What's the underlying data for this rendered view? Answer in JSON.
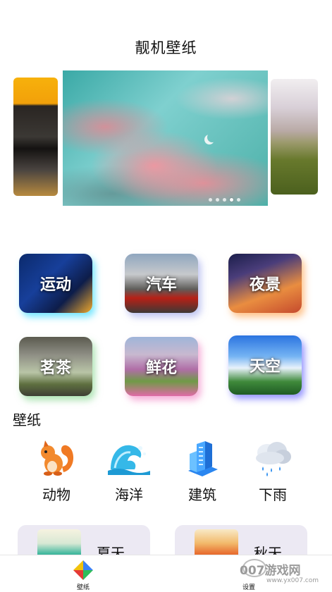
{
  "header": {
    "title": "靓机壁纸"
  },
  "carousel": {
    "dots": 5,
    "active_index": 3
  },
  "categories": [
    {
      "label": "运动"
    },
    {
      "label": "汽车"
    },
    {
      "label": "夜景"
    },
    {
      "label": "茗茶"
    },
    {
      "label": "鲜花"
    },
    {
      "label": "天空"
    }
  ],
  "wallpaper_section": {
    "title": "壁纸",
    "items": [
      {
        "label": "动物",
        "icon": "squirrel-icon"
      },
      {
        "label": "海洋",
        "icon": "wave-icon"
      },
      {
        "label": "建筑",
        "icon": "building-icon"
      },
      {
        "label": "下雨",
        "icon": "rain-cloud-icon"
      }
    ]
  },
  "seasons": [
    {
      "label": "夏天"
    },
    {
      "label": "秋天"
    }
  ],
  "tabbar": {
    "items": [
      {
        "label": "壁纸",
        "icon": "colorful-diamond-icon"
      },
      {
        "label": "设置",
        "icon": "settings-icon"
      }
    ]
  },
  "watermark": {
    "text": "007游戏网",
    "url": "www.yx007.com"
  },
  "colors": {
    "accent_blue": "#2a86f0",
    "card_bg": "#ece9f3"
  }
}
